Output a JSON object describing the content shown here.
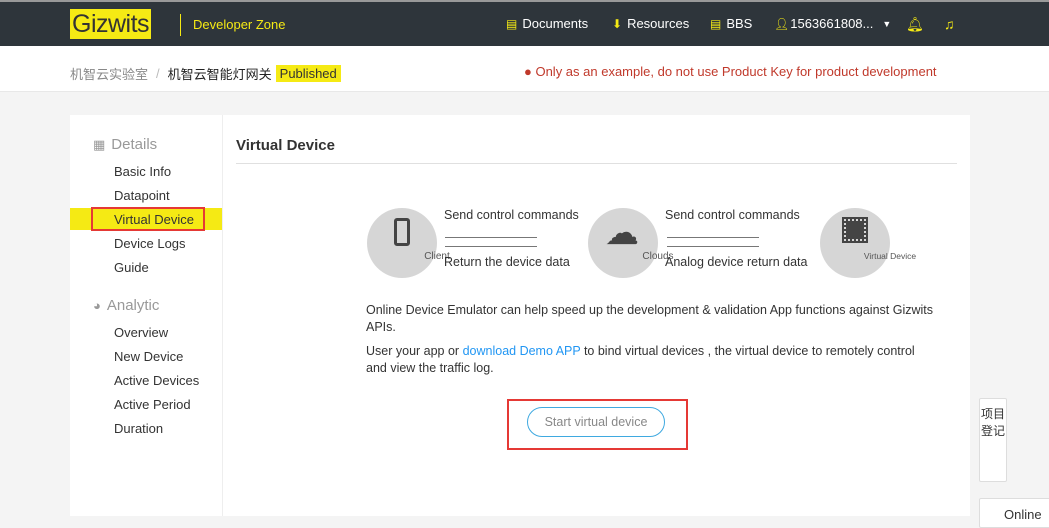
{
  "header": {
    "logo": "Gizwits",
    "zone": "Developer Zone",
    "nav": [
      "Documents",
      "Resources",
      "BBS"
    ],
    "user": "1563661808...",
    "icons": [
      "bell-icon",
      "headset-icon"
    ]
  },
  "breadcrumb": {
    "parent": "机智云实验室",
    "current": "机智云智能灯网关",
    "badge": "Published",
    "warning": "Only as an example, do not use Product Key for product development"
  },
  "sidebar": {
    "details": "Details",
    "details_items": [
      "Basic Info",
      "Datapoint",
      "Virtual Device",
      "Device Logs",
      "Guide"
    ],
    "analytic": "Analytic",
    "analytic_items": [
      "Overview",
      "New Device",
      "Active Devices",
      "Active Period",
      "Duration"
    ]
  },
  "main": {
    "title": "Virtual Device",
    "diagram": {
      "client": "Client",
      "clouds": "Clouds",
      "virtual": "Virtual Device",
      "send1": "Send control commands",
      "ret1": "Return the device data",
      "send2": "Send control commands",
      "ret2": "Analog device return data"
    },
    "p1": "Online Device Emulator can help speed up the development & validation App functions against Gizwits APIs.",
    "p2a": "User your app or ",
    "p2link": "download Demo APP",
    "p2b": " to bind virtual devices , the virtual device to remotely control and view the traffic log.",
    "button": "Start virtual device"
  },
  "float": {
    "register": "项目登记",
    "online": "Online"
  }
}
